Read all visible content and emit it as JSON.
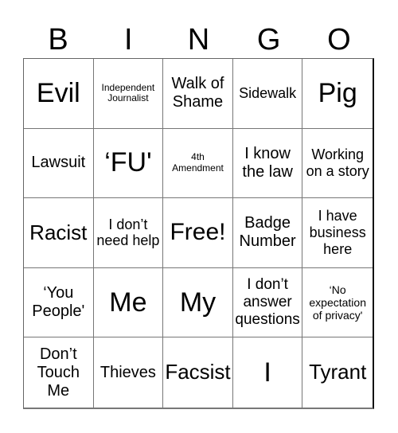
{
  "header": {
    "letters": [
      "B",
      "I",
      "N",
      "G",
      "O"
    ]
  },
  "cells": [
    {
      "text": "Evil",
      "size": "s-xl"
    },
    {
      "text": "Independent Journalist",
      "size": "s-xxs"
    },
    {
      "text": "Walk of Shame",
      "size": "s-m"
    },
    {
      "text": "Sidewalk",
      "size": "s-s"
    },
    {
      "text": "Pig",
      "size": "s-xl"
    },
    {
      "text": "Lawsuit",
      "size": "s-m"
    },
    {
      "text": "‘FU'",
      "size": "s-xl"
    },
    {
      "text": "4th Amendment",
      "size": "s-xxs"
    },
    {
      "text": "I know the law",
      "size": "s-m"
    },
    {
      "text": "Working on a story",
      "size": "s-s"
    },
    {
      "text": "Racist",
      "size": "s-ml"
    },
    {
      "text": "I don’t need help",
      "size": "s-s"
    },
    {
      "text": "Free!",
      "size": "s-l"
    },
    {
      "text": "Badge Number",
      "size": "s-m"
    },
    {
      "text": "I have business here",
      "size": "s-s"
    },
    {
      "text": "‘You People'",
      "size": "s-m"
    },
    {
      "text": "Me",
      "size": "s-xl"
    },
    {
      "text": "My",
      "size": "s-xl"
    },
    {
      "text": "I don’t answer questions",
      "size": "s-ms"
    },
    {
      "text": "‘No expectation of privacy'",
      "size": "s-xs"
    },
    {
      "text": "Don’t Touch Me",
      "size": "s-m"
    },
    {
      "text": "Thieves",
      "size": "s-m"
    },
    {
      "text": "Facsist",
      "size": "s-ml"
    },
    {
      "text": "I",
      "size": "s-xl"
    },
    {
      "text": "Tyrant",
      "size": "s-ml"
    }
  ]
}
